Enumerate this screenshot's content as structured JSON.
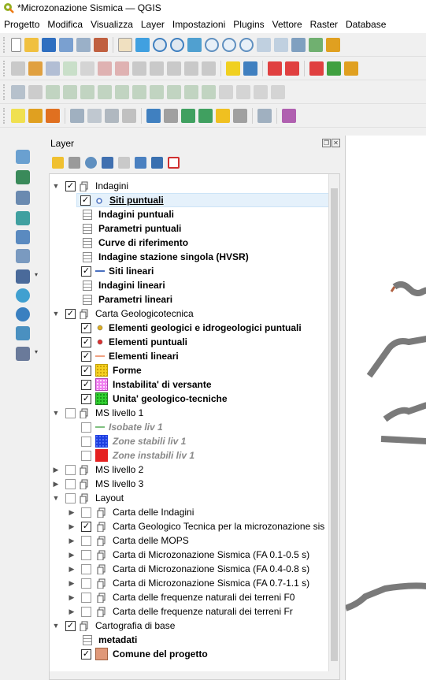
{
  "window": {
    "title": "*Microzonazione Sismica — QGIS"
  },
  "menu": [
    "Progetto",
    "Modifica",
    "Visualizza",
    "Layer",
    "Impostazioni",
    "Plugins",
    "Vettore",
    "Raster",
    "Database"
  ],
  "panel": {
    "title": "Layer",
    "float_glyph": "❐",
    "close_glyph": "✕"
  },
  "glyphs": {
    "check": "✓",
    "expanded": "▼",
    "collapsed": "▶",
    "drop": "▾"
  },
  "layers": {
    "indagini": {
      "label": "Indagini",
      "checked": true,
      "expanded": true
    },
    "siti_puntuali": {
      "label": "Siti puntuali",
      "checked": true,
      "selected": true
    },
    "indagini_puntuali": {
      "label": "Indagini puntuali"
    },
    "parametri_puntuali": {
      "label": "Parametri puntuali"
    },
    "curve_riferimento": {
      "label": "Curve di riferimento"
    },
    "indagine_hvsr": {
      "label": "Indagine stazione singola (HVSR)"
    },
    "siti_lineari": {
      "label": "Siti lineari",
      "checked": true
    },
    "indagini_lineari": {
      "label": "Indagini lineari"
    },
    "parametri_lineari": {
      "label": "Parametri lineari"
    },
    "carta_geo": {
      "label": "Carta Geologicotecnica",
      "checked": true,
      "expanded": true
    },
    "elem_geo_idro": {
      "label": "Elementi geologici e idrogeologici puntuali",
      "checked": true,
      "color": "#e0b020"
    },
    "elem_puntuali": {
      "label": "Elementi puntuali",
      "checked": true,
      "color": "#e03030"
    },
    "elem_lineari": {
      "label": "Elementi lineari",
      "checked": true,
      "color": "#f0a080"
    },
    "forme": {
      "label": "Forme",
      "checked": true,
      "color": "#f5d020"
    },
    "instabilita": {
      "label": "Instabilita' di versante",
      "checked": true,
      "color": "#ef7fef"
    },
    "unita_geo": {
      "label": "Unita' geologico-tecniche",
      "checked": true,
      "color": "#30d030"
    },
    "ms1": {
      "label": "MS livello 1",
      "checked": false,
      "expanded": true
    },
    "isobate": {
      "label": "Isobate liv 1",
      "checked": false,
      "color": "#80c080"
    },
    "zone_stabili": {
      "label": "Zone stabili liv 1",
      "checked": false,
      "color": "#1f3fe0"
    },
    "zone_instabili": {
      "label": "Zone instabili liv 1",
      "checked": false,
      "color": "#e52020"
    },
    "ms2": {
      "label": "MS livello 2",
      "checked": false,
      "expanded": false
    },
    "ms3": {
      "label": "MS livello 3",
      "checked": false,
      "expanded": false
    },
    "layout": {
      "label": "Layout",
      "checked": false,
      "expanded": true
    },
    "carta_indagini": {
      "label": "Carta delle Indagini",
      "checked": false
    },
    "carta_geo_tec": {
      "label": "Carta Geologico Tecnica per la microzonazione sis",
      "checked": true
    },
    "carta_mops": {
      "label": "Carta delle MOPS",
      "checked": false
    },
    "carta_ms1": {
      "label": "Carta di Microzonazione Sismica (FA 0.1-0.5 s)",
      "checked": false
    },
    "carta_ms2": {
      "label": "Carta di Microzonazione Sismica (FA 0.4-0.8 s)",
      "checked": false
    },
    "carta_ms3": {
      "label": "Carta di Microzonazione Sismica (FA 0.7-1.1 s)",
      "checked": false
    },
    "carta_f0": {
      "label": "Carta delle frequenze naturali dei terreni F0",
      "checked": false
    },
    "carta_fr": {
      "label": "Carta delle frequenze naturali dei terreni Fr",
      "checked": false
    },
    "cartografia": {
      "label": "Cartografia di base",
      "checked": true,
      "expanded": true
    },
    "metadati": {
      "label": "metadati"
    },
    "comune": {
      "label": "Comune del progetto",
      "checked": true,
      "color": "#e09878"
    }
  }
}
